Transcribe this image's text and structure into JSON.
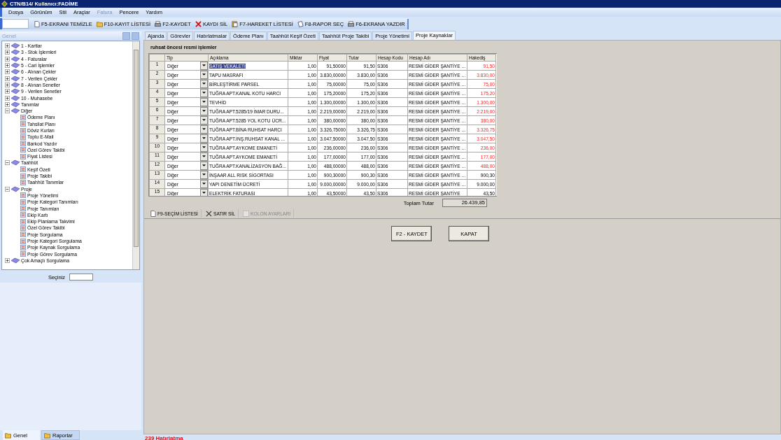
{
  "window": {
    "title": "CTN/B14/ Kullanıcı:FADİME"
  },
  "menu": [
    {
      "label": "Dosya",
      "disabled": false
    },
    {
      "label": "Görünüm",
      "disabled": false
    },
    {
      "label": "Stil",
      "disabled": false
    },
    {
      "label": "Araçlar",
      "disabled": false
    },
    {
      "label": "Fatura",
      "disabled": true
    },
    {
      "label": "Pencere",
      "disabled": false
    },
    {
      "label": "Yardım",
      "disabled": false
    }
  ],
  "toolbar": [
    {
      "label": "F5-EKRANI TEMİZLE",
      "kind": "page"
    },
    {
      "label": "F10-KAYIT LİSTESİ",
      "kind": "folder"
    },
    {
      "label": "F2-KAYDET",
      "kind": "printer"
    },
    {
      "label": "KAYDI SİL",
      "kind": "cross"
    },
    {
      "label": "F7-HAREKET LİSTESİ",
      "kind": "clipboard"
    },
    {
      "label": "F8-RAPOR SEÇ",
      "kind": "note"
    },
    {
      "label": "F6-EKRANA YAZDIR",
      "kind": "printer"
    }
  ],
  "sidebar": {
    "title": "Genel",
    "tree": [
      {
        "label": "1 - Kartlar",
        "expanded": false
      },
      {
        "label": "3 - Stok İşlemleri",
        "expanded": false
      },
      {
        "label": "4 - Faturalar",
        "expanded": false
      },
      {
        "label": "5 - Cari İşlemler",
        "expanded": false
      },
      {
        "label": "6 - Alınan Çekler",
        "expanded": false
      },
      {
        "label": "7 - Verilen Çekler",
        "expanded": false
      },
      {
        "label": "8 - Alınan Senetler",
        "expanded": false
      },
      {
        "label": "9 - Verilen Senetler",
        "expanded": false
      },
      {
        "label": "10 - Muhasebe",
        "expanded": false
      },
      {
        "label": "Tanımlar",
        "expanded": false
      },
      {
        "label": "Diğer",
        "expanded": true,
        "children": [
          {
            "label": "Ödeme Planı"
          },
          {
            "label": "Tahsilat Planı"
          },
          {
            "label": "Döviz Kurları"
          },
          {
            "label": "Toplu E-Mail"
          },
          {
            "label": "Barkod Yazdır"
          },
          {
            "label": "Özel Görev Takibi"
          },
          {
            "label": "Fiyat Listesi"
          }
        ]
      },
      {
        "label": "Taahhüt",
        "expanded": true,
        "children": [
          {
            "label": "Keşif Özeti"
          },
          {
            "label": "Proje Takibi"
          },
          {
            "label": "Taahhüt Tanımlar"
          }
        ]
      },
      {
        "label": "Proje",
        "expanded": true,
        "children": [
          {
            "label": "Proje Yönetimi"
          },
          {
            "label": "Proje Kategori Tanımları"
          },
          {
            "label": "Proje Tanımları"
          },
          {
            "label": "Ekip Kartı"
          },
          {
            "label": "Ekip Planlama Takvimi"
          },
          {
            "label": "Özel Görev Takibi"
          },
          {
            "label": "Proje Sorgulama"
          },
          {
            "label": "Proje Kategori Sorgulama"
          },
          {
            "label": "Proje Kaynak Sorgulama"
          },
          {
            "label": "Proje Görev Sorgulama"
          }
        ]
      },
      {
        "label": "Çok Amaçlı Sorgulama",
        "expanded": false
      }
    ],
    "select_label": "Seçiniz",
    "bottom_tabs": [
      {
        "label": "Genel",
        "selected": true
      },
      {
        "label": "Raporlar",
        "selected": false
      }
    ]
  },
  "tabs": [
    {
      "label": "Ajanda",
      "selected": false
    },
    {
      "label": "Görevler",
      "selected": false
    },
    {
      "label": "Hatırlatmalar",
      "selected": false
    },
    {
      "label": "Ödeme Planı",
      "selected": false
    },
    {
      "label": "Taahhüt Keşif Özeti",
      "selected": false
    },
    {
      "label": "Taahhüt Proje Takibi",
      "selected": false
    },
    {
      "label": "Proje Yönetimi",
      "selected": false
    },
    {
      "label": "Proje Kaynaklar",
      "selected": true
    }
  ],
  "section_title": "ruhsat öncesi resmi işlemler",
  "table": {
    "columns": [
      "Tip",
      "Açıklama",
      "Miktar",
      "Fiyat",
      "Tutar",
      "Hesap Kodu",
      "Hesap Adı",
      "Hakediş"
    ],
    "rows": [
      {
        "no": "1",
        "tip": "Diğer",
        "aciklama": "SATIŞ VEKALETİ",
        "miktar": "1,00",
        "fiyat": "91,50000",
        "tutar": "91,50",
        "kod": "S306",
        "ad": "RESMİ GİDER ŞANTİYE ...",
        "hakedis": "91,50",
        "highlighted": true,
        "selected": true
      },
      {
        "no": "2",
        "tip": "Diğer",
        "aciklama": "TAPU MASRAFI",
        "miktar": "1,00",
        "fiyat": "3.830,00000",
        "tutar": "3.830,00",
        "kod": "S306",
        "ad": "RESMİ GİDER ŞANTİYE ...",
        "hakedis": "3.830,00",
        "highlighted": true,
        "selected": false
      },
      {
        "no": "3",
        "tip": "Diğer",
        "aciklama": "BİRLEŞTİRME PARSEL",
        "miktar": "1,00",
        "fiyat": "75,00000",
        "tutar": "75,00",
        "kod": "S306",
        "ad": "RESMİ GİDER ŞANTİYE ...",
        "hakedis": "75,00",
        "highlighted": true,
        "selected": false
      },
      {
        "no": "4",
        "tip": "Diğer",
        "aciklama": "TUĞRA APT.KANAL KOTU HARCI",
        "miktar": "1,00",
        "fiyat": "175,20000",
        "tutar": "175,20",
        "kod": "S306",
        "ad": "RESMİ GİDER ŞANTİYE ...",
        "hakedis": "175,20",
        "highlighted": true,
        "selected": false
      },
      {
        "no": "5",
        "tip": "Diğer",
        "aciklama": "TEVHİD",
        "miktar": "1,00",
        "fiyat": "1.300,00000",
        "tutar": "1.300,00",
        "kod": "S306",
        "ad": "RESMİ GİDER ŞANTİYE ...",
        "hakedis": "1.300,00",
        "highlighted": true,
        "selected": false
      },
      {
        "no": "6",
        "tip": "Diğer",
        "aciklama": "TUĞRA APT.5285/19 İMAR DURU...",
        "miktar": "1,00",
        "fiyat": "2.219,00000",
        "tutar": "2.219,00",
        "kod": "S306",
        "ad": "RESMİ GİDER ŞANTİYE ...",
        "hakedis": "2.219,00",
        "highlighted": true,
        "selected": false
      },
      {
        "no": "7",
        "tip": "Diğer",
        "aciklama": "TUĞRA APT.5285 YOL KOTU ÜCR...",
        "miktar": "1,00",
        "fiyat": "380,00000",
        "tutar": "380,00",
        "kod": "S306",
        "ad": "RESMİ GİDER ŞANTİYE ...",
        "hakedis": "380,00",
        "highlighted": true,
        "selected": false
      },
      {
        "no": "8",
        "tip": "Diğer",
        "aciklama": "TUĞRA APT.BİNA RUHSAT HARCI",
        "miktar": "1,00",
        "fiyat": "3.326,75000",
        "tutar": "3.326,75",
        "kod": "S306",
        "ad": "RESMİ GİDER ŞANTİYE ...",
        "hakedis": "3.326,75",
        "highlighted": true,
        "selected": false
      },
      {
        "no": "9",
        "tip": "Diğer",
        "aciklama": "TUĞRA APT.İNŞ.RUHSAT KANAL ...",
        "miktar": "1,00",
        "fiyat": "3.047,50000",
        "tutar": "3.047,50",
        "kod": "S306",
        "ad": "RESMİ GİDER ŞANTİYE ...",
        "hakedis": "3.047,50",
        "highlighted": true,
        "selected": false
      },
      {
        "no": "10",
        "tip": "Diğer",
        "aciklama": "TUĞRA APT.AYKOME EMANETİ",
        "miktar": "1,00",
        "fiyat": "236,00000",
        "tutar": "236,00",
        "kod": "S306",
        "ad": "RESMİ GİDER ŞANTİYE ...",
        "hakedis": "236,00",
        "highlighted": true,
        "selected": false
      },
      {
        "no": "11",
        "tip": "Diğer",
        "aciklama": "TUĞRA APT.AYKOME EMANETİ",
        "miktar": "1,00",
        "fiyat": "177,00000",
        "tutar": "177,00",
        "kod": "S306",
        "ad": "RESMİ GİDER ŞANTİYE ...",
        "hakedis": "177,00",
        "highlighted": true,
        "selected": false
      },
      {
        "no": "12",
        "tip": "Diğer",
        "aciklama": "TUĞRA APT.KANALİZASYON BAĞ...",
        "miktar": "1,00",
        "fiyat": "488,00000",
        "tutar": "488,00",
        "kod": "S306",
        "ad": "RESMİ GİDER ŞANTİYE ...",
        "hakedis": "488,00",
        "highlighted": true,
        "selected": false
      },
      {
        "no": "13",
        "tip": "Diğer",
        "aciklama": "İNŞAAR ALL RISK SİGORTASI",
        "miktar": "1,00",
        "fiyat": "900,30000",
        "tutar": "900,30",
        "kod": "S306",
        "ad": "RESMİ GİDER ŞANTİYE ...",
        "hakedis": "900,30",
        "highlighted": false,
        "selected": false
      },
      {
        "no": "14",
        "tip": "Diğer",
        "aciklama": "YAPI DENETİM ÜCRETİ",
        "miktar": "1,00",
        "fiyat": "9.000,00000",
        "tutar": "9.000,00",
        "kod": "S306",
        "ad": "RESMİ GİDER ŞANTİYE ...",
        "hakedis": "9.000,00",
        "highlighted": false,
        "selected": false
      },
      {
        "no": "15",
        "tip": "Diğer",
        "aciklama": "ELEKTRİK FATURASI",
        "miktar": "1,00",
        "fiyat": "43,50000",
        "tutar": "43,50",
        "kod": "S306",
        "ad": "RESMİ GİDER ŞANTİYE",
        "hakedis": "43,50",
        "highlighted": false,
        "selected": false
      }
    ]
  },
  "total": {
    "label": "Toplam Tutar",
    "value": "26.439,85"
  },
  "grid_toolbar": [
    {
      "label": "F9-SEÇİM LİSTESİ",
      "kind": "page",
      "disabled": false
    },
    {
      "label": "SATIR SİL",
      "kind": "cross",
      "disabled": false
    },
    {
      "label": "KOLON AYARLARI",
      "kind": "grid",
      "disabled": true
    }
  ],
  "buttons": [
    "F2 - KAYDET",
    "KAPAT"
  ],
  "status": "239 Hatırlatma"
}
